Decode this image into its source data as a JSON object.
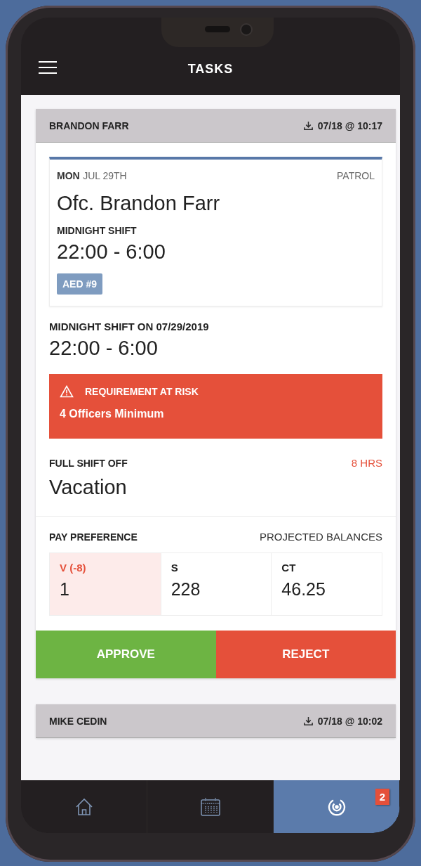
{
  "app_bar": {
    "title": "TASKS"
  },
  "tasks": [
    {
      "name": "BRANDON FARR",
      "timestamp": "07/18 @ 10:17",
      "shift_card": {
        "day": "MON",
        "date": "JUL 29TH",
        "assignment": "PATROL",
        "officer": "Ofc. Brandon Farr",
        "shift_label": "MIDNIGHT SHIFT",
        "hours": "22:00 - 6:00",
        "tag": "AED #9"
      },
      "request_heading": "MIDNIGHT SHIFT ON 07/29/2019",
      "request_hours": "22:00 - 6:00",
      "alert": {
        "title": "REQUIREMENT AT RISK",
        "message": "4 Officers Minimum"
      },
      "leave_label": "FULL SHIFT OFF",
      "leave_amount": "8 HRS",
      "leave_type": "Vacation",
      "pay_label": "PAY PREFERENCE",
      "balances_label": "PROJECTED BALANCES",
      "balances": [
        {
          "label": "V (-8)",
          "value": "1",
          "selected": true
        },
        {
          "label": "S",
          "value": "228",
          "selected": false
        },
        {
          "label": "CT",
          "value": "46.25",
          "selected": false
        }
      ],
      "actions": [
        {
          "label": "APPROVE",
          "kind": "approve"
        },
        {
          "label": "REJECT",
          "kind": "reject"
        }
      ]
    },
    {
      "name": "MIKE CEDIN",
      "timestamp": "07/18 @ 10:02"
    }
  ],
  "nav": [
    {
      "kind": "home",
      "selected": false
    },
    {
      "kind": "calendar",
      "selected": false
    },
    {
      "kind": "target",
      "selected": true,
      "badge": "2"
    }
  ]
}
